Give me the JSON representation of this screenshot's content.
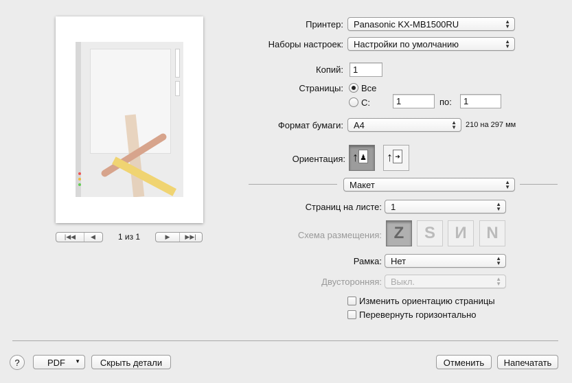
{
  "preview": {
    "page_counter": "1 из 1",
    "first_icon": "first-page-icon",
    "prev_icon": "prev-page-icon",
    "next_icon": "next-page-icon",
    "last_icon": "last-page-icon"
  },
  "printer": {
    "label": "Принтер:",
    "value": "Panasonic KX-MB1500RU"
  },
  "presets": {
    "label": "Наборы настроек:",
    "value": "Настройки по умолчанию"
  },
  "copies": {
    "label": "Копий:",
    "value": "1"
  },
  "pages": {
    "label": "Страницы:",
    "all": "Все",
    "range": "С:",
    "from": "1",
    "to_label": "по:",
    "to": "1",
    "selected": "all"
  },
  "paper": {
    "label": "Формат бумаги:",
    "value": "A4",
    "size": "210 на 297 мм"
  },
  "orientation": {
    "label": "Ориентация:",
    "selected": "portrait"
  },
  "section": {
    "value": "Макет"
  },
  "layout": {
    "pages_per_sheet": {
      "label": "Страниц на листе:",
      "value": "1"
    },
    "direction": {
      "label": "Схема размещения:",
      "options": [
        "Z",
        "S",
        "И",
        "N"
      ],
      "selected": 0
    },
    "border": {
      "label": "Рамка:",
      "value": "Нет"
    },
    "two_sided": {
      "label": "Двусторонняя:",
      "value": "Выкл."
    },
    "reverse_orientation": {
      "label": "Изменить ориентацию страницы",
      "checked": false
    },
    "flip_horizontal": {
      "label": "Перевернуть горизонтально",
      "checked": false
    }
  },
  "footer": {
    "help": "?",
    "pdf": "PDF",
    "hide_details": "Скрыть детали",
    "cancel": "Отменить",
    "print": "Напечатать"
  }
}
